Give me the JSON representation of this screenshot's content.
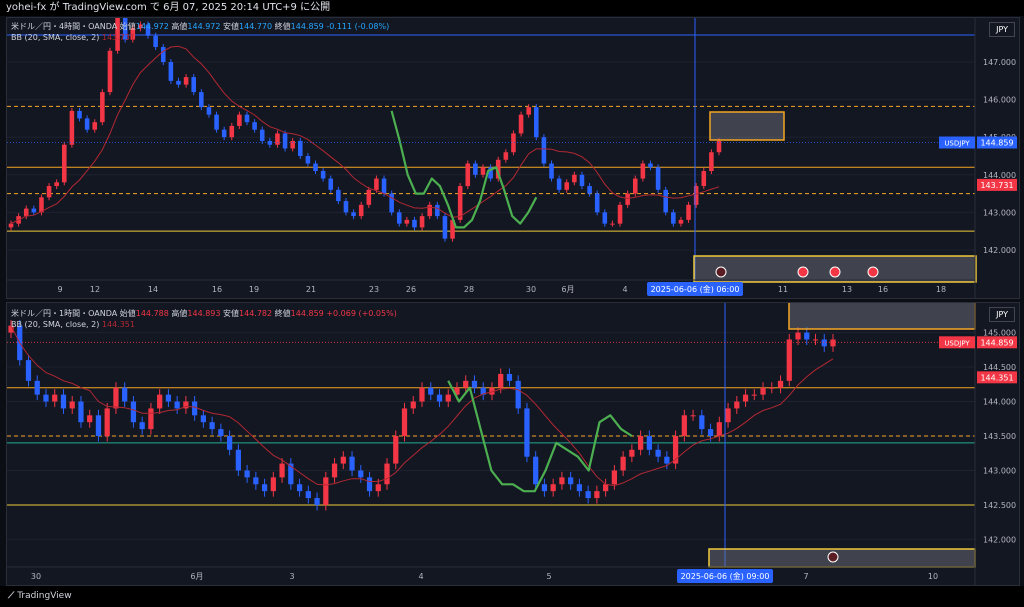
{
  "header": {
    "publish_text": "yohei-fx が TradingView.com で 6月 07, 2025 20:14 UTC+9 に公開"
  },
  "footer": {
    "brand": "TradingView"
  },
  "colors": {
    "up": "#f23645",
    "down": "#2962ff",
    "bb": "#b22833",
    "wave": "#4caf50",
    "orange": "#f5a623",
    "yellow": "#f0c93a",
    "price_tag": "#2962ff",
    "red_tag": "#f23645"
  },
  "chart_data": [
    {
      "type": "candlestick",
      "legend": {
        "symbol": "米ドル／円・4時間・OANDA",
        "open_label": "始値",
        "open": "144.972",
        "high_label": "高値",
        "high": "144.972",
        "low_label": "安値",
        "low": "144.770",
        "close_label": "終値",
        "close": "144.859",
        "change": "-0.111 (-0.08%)",
        "bb_label": "BB (20, SMA, close, 2)",
        "bb_value": "143.731"
      },
      "currency": "JPY",
      "price_tag": {
        "label": "USDJPY",
        "value": "144.859"
      },
      "bb_tag": "143.731",
      "ylim": [
        141.2,
        147.8
      ],
      "y_ticks": [
        "147.000",
        "146.000",
        "145.000",
        "144.000",
        "143.000",
        "142.000"
      ],
      "x_ticks": [
        "9",
        "12",
        "14",
        "16",
        "19",
        "21",
        "23",
        "26",
        "28",
        "30",
        "6月",
        "4",
        "11",
        "13",
        "16",
        "18"
      ],
      "cursor_label": "2025-06-06 (金)  06:00",
      "levels": [
        {
          "price": 147.72,
          "color": "#2962ff",
          "style": "solid"
        },
        {
          "price": 145.82,
          "color": "#f5a623",
          "style": "dashed"
        },
        {
          "price": 144.2,
          "color": "#f5a623",
          "style": "solid"
        },
        {
          "price": 143.5,
          "color": "#f5a623",
          "style": "dashed"
        },
        {
          "price": 142.5,
          "color": "#f0c93a",
          "style": "solid"
        }
      ],
      "candles": [
        142.7,
        142.9,
        143.1,
        143.0,
        143.4,
        143.7,
        143.8,
        144.8,
        145.7,
        145.5,
        145.2,
        145.4,
        146.2,
        147.3,
        148.4,
        147.6,
        147.9,
        148.0,
        147.7,
        147.4,
        147.0,
        146.5,
        146.4,
        146.6,
        146.2,
        145.8,
        145.6,
        145.2,
        145.0,
        145.3,
        145.6,
        145.4,
        145.2,
        144.9,
        144.8,
        145.1,
        144.7,
        144.9,
        144.5,
        144.3,
        144.1,
        143.9,
        143.6,
        143.3,
        143.0,
        142.9,
        143.2,
        143.6,
        143.9,
        143.5,
        143.0,
        142.7,
        142.8,
        142.6,
        142.9,
        143.2,
        142.9,
        142.3,
        142.8,
        143.7,
        144.3,
        144.0,
        144.2,
        143.9,
        144.4,
        144.6,
        145.1,
        145.6,
        145.8,
        145.0,
        144.3,
        143.9,
        143.6,
        143.8,
        144.0,
        143.7,
        143.5,
        143.0,
        142.7,
        142.7,
        143.2,
        143.5,
        143.9,
        144.3,
        144.2,
        143.6,
        143.0,
        142.7,
        142.8,
        143.2,
        143.7,
        144.1,
        144.6,
        144.9
      ],
      "wave": [
        [
          145.7,
          144.9,
          144.0,
          143.5,
          143.5,
          143.9,
          143.7,
          143.2,
          142.6,
          142.6,
          142.8,
          143.3,
          144.1,
          144.2,
          143.6,
          142.9,
          142.7,
          143.0,
          143.4
        ]
      ]
    },
    {
      "type": "candlestick",
      "legend": {
        "symbol": "米ドル／円・1時間・OANDA",
        "open_label": "始値",
        "open": "144.788",
        "high_label": "高値",
        "high": "144.893",
        "low_label": "安値",
        "low": "144.782",
        "close_label": "終値",
        "close": "144.859",
        "change": "+0.069 (+0.05%)",
        "bb_label": "BB (20, SMA, close, 2)",
        "bb_value": "144.351"
      },
      "currency": "JPY",
      "price_tag": {
        "label": "USDJPY",
        "value": "144.859"
      },
      "bb_tag": "144.351",
      "ylim": [
        141.6,
        145.4
      ],
      "y_ticks": [
        "145.000",
        "144.500",
        "144.000",
        "143.500",
        "143.000",
        "142.500",
        "142.000"
      ],
      "x_ticks": [
        "30",
        "6月",
        "3",
        "4",
        "5",
        "6",
        "7",
        "10"
      ],
      "cursor_label": "2025-06-06 (金)  09:00",
      "levels": [
        {
          "price": 144.2,
          "color": "#f5a623",
          "style": "solid"
        },
        {
          "price": 143.5,
          "color": "#f5a623",
          "style": "dashed"
        },
        {
          "price": 143.4,
          "color": "#22ab94",
          "style": "solid"
        },
        {
          "price": 142.5,
          "color": "#f0c93a",
          "style": "solid"
        }
      ],
      "candles": [
        145.1,
        144.6,
        144.3,
        144.1,
        144.0,
        144.1,
        143.9,
        144.0,
        143.7,
        143.8,
        143.5,
        143.9,
        144.2,
        144.0,
        143.7,
        143.6,
        143.9,
        144.1,
        144.0,
        143.9,
        144.0,
        143.8,
        143.7,
        143.6,
        143.5,
        143.3,
        143.0,
        142.9,
        142.8,
        142.7,
        142.9,
        143.1,
        142.8,
        142.7,
        142.6,
        142.5,
        142.9,
        143.1,
        143.2,
        143.0,
        142.9,
        142.7,
        142.8,
        143.1,
        143.5,
        143.9,
        144.0,
        144.2,
        144.1,
        144.0,
        144.1,
        144.2,
        144.3,
        144.2,
        144.1,
        144.2,
        144.4,
        144.3,
        143.9,
        143.2,
        142.8,
        142.7,
        142.8,
        142.9,
        142.8,
        142.7,
        142.6,
        142.7,
        142.8,
        143.0,
        143.2,
        143.3,
        143.5,
        143.3,
        143.2,
        143.1,
        143.5,
        143.8,
        143.8,
        143.6,
        143.5,
        143.7,
        143.9,
        144.0,
        144.1,
        144.1,
        144.2,
        144.2,
        144.3,
        144.9,
        145.0,
        144.9,
        144.9,
        144.8,
        144.9
      ],
      "wave": [
        [
          144.3,
          144.0,
          144.2,
          143.6,
          143.0,
          142.8,
          142.8,
          142.7,
          142.7,
          143.0,
          143.4,
          143.3,
          143.2,
          143.0,
          143.7,
          143.8,
          143.6,
          143.5
        ]
      ]
    }
  ]
}
